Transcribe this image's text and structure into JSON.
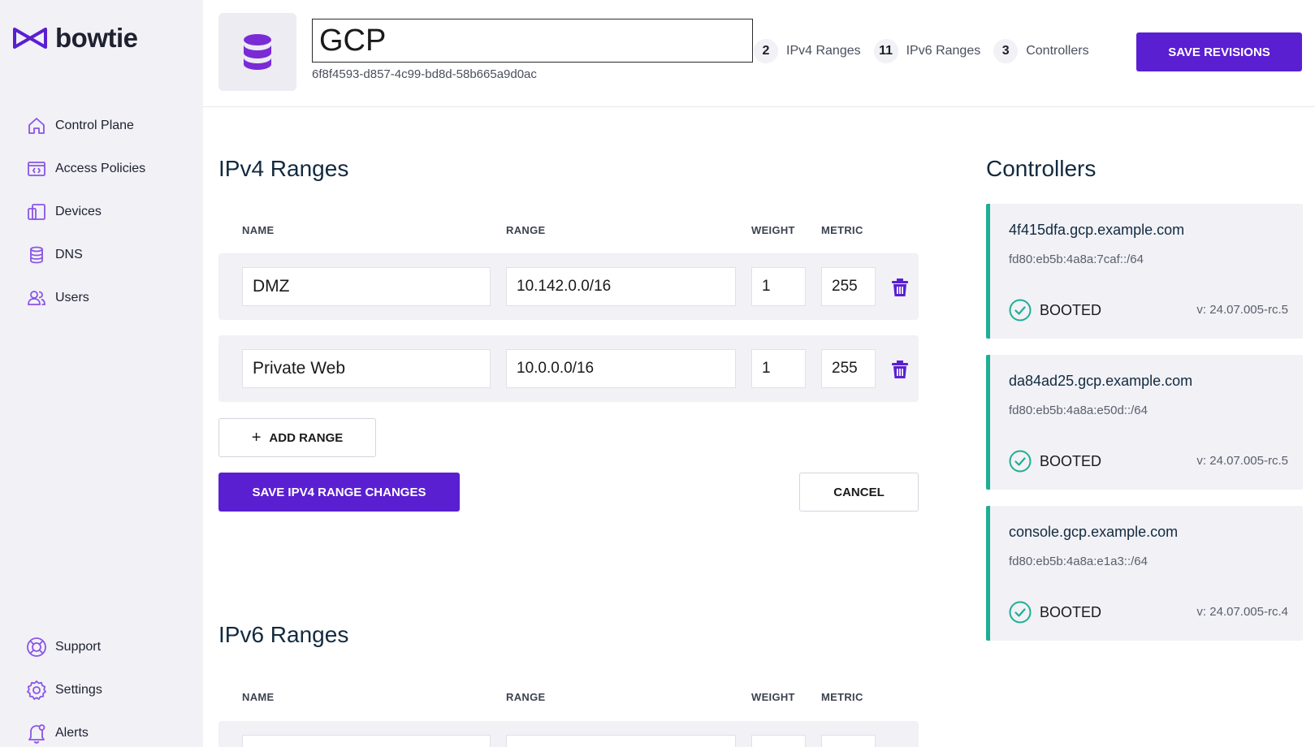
{
  "brand": {
    "name": "bowtie",
    "accent": "#5a1fd1",
    "success": "#1fae94"
  },
  "sidebar": {
    "items": [
      {
        "label": "Control Plane",
        "icon": "home-icon"
      },
      {
        "label": "Access Policies",
        "icon": "code-window-icon"
      },
      {
        "label": "Devices",
        "icon": "devices-icon"
      },
      {
        "label": "DNS",
        "icon": "database-icon"
      },
      {
        "label": "Users",
        "icon": "users-icon"
      }
    ],
    "bottom_items": [
      {
        "label": "Support",
        "icon": "lifebuoy-icon"
      },
      {
        "label": "Settings",
        "icon": "gear-icon"
      },
      {
        "label": "Alerts",
        "icon": "bell-icon"
      }
    ]
  },
  "header": {
    "name_value": "GCP",
    "uuid": "6f8f4593-d857-4c99-bd8d-58b665a9d0ac",
    "stats": [
      {
        "count": "2",
        "label": "IPv4 Ranges"
      },
      {
        "count": "11",
        "label": "IPv6 Ranges"
      },
      {
        "count": "3",
        "label": "Controllers"
      }
    ],
    "save_label": "SAVE REVISIONS"
  },
  "ipv4": {
    "title": "IPv4 Ranges",
    "columns": {
      "name": "NAME",
      "range": "RANGE",
      "weight": "WEIGHT",
      "metric": "METRIC"
    },
    "rows": [
      {
        "name": "DMZ",
        "range": "10.142.0.0/16",
        "weight": "1",
        "metric": "255"
      },
      {
        "name": "Private Web",
        "range": "10.0.0.0/16",
        "weight": "1",
        "metric": "255"
      }
    ],
    "add_label": "ADD RANGE",
    "save_label": "SAVE IPV4 RANGE CHANGES",
    "cancel_label": "CANCEL"
  },
  "ipv6": {
    "title": "IPv6 Ranges",
    "columns": {
      "name": "NAME",
      "range": "RANGE",
      "weight": "WEIGHT",
      "metric": "METRIC"
    }
  },
  "controllers": {
    "title": "Controllers",
    "items": [
      {
        "host": "4f415dfa.gcp.example.com",
        "ip": "fd80:eb5b:4a8a:7caf::/64",
        "status": "BOOTED",
        "version": "v: 24.07.005-rc.5"
      },
      {
        "host": "da84ad25.gcp.example.com",
        "ip": "fd80:eb5b:4a8a:e50d::/64",
        "status": "BOOTED",
        "version": "v: 24.07.005-rc.5"
      },
      {
        "host": "console.gcp.example.com",
        "ip": "fd80:eb5b:4a8a:e1a3::/64",
        "status": "BOOTED",
        "version": "v: 24.07.005-rc.4"
      }
    ]
  }
}
